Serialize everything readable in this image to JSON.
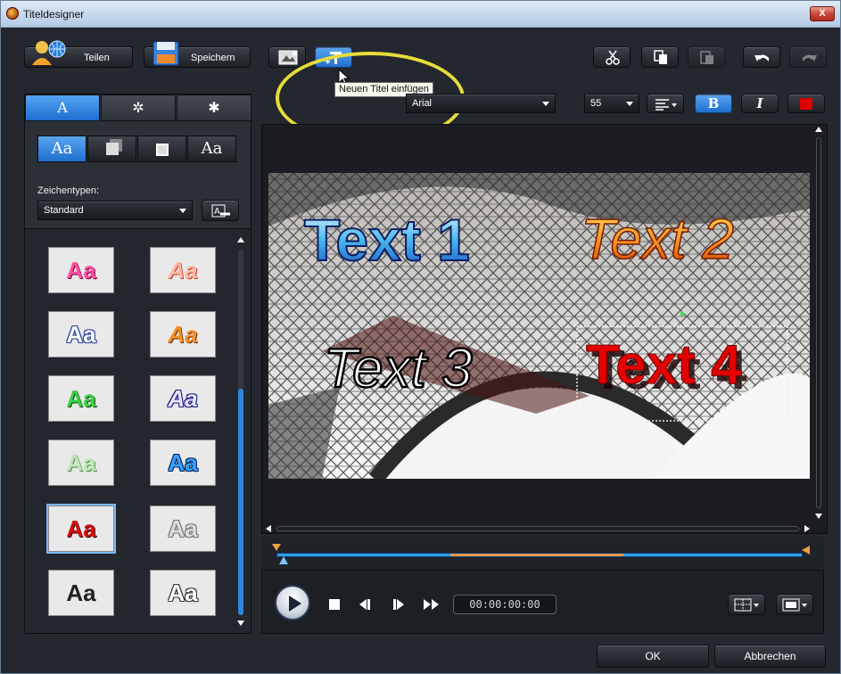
{
  "window": {
    "title": "Titeldesigner",
    "close_glyph": "X"
  },
  "toolbar": {
    "share_label": "Teilen",
    "save_label": "Speichern",
    "tooltip": "Neuen Titel einfügen"
  },
  "format": {
    "font": "Arial",
    "size": "55",
    "bold_label": "B",
    "italic_label": "I",
    "color": "#e00000"
  },
  "left_panel": {
    "tabs": [
      "A",
      "✲",
      "✱"
    ],
    "segments": [
      "Aa",
      "",
      "",
      "Aa"
    ],
    "charset_label": "Zeichentypen:",
    "charset_value": "Standard",
    "presets": [
      "Aa",
      "Aa",
      "Aa",
      "Aa",
      "Aa",
      "Aa",
      "Aa",
      "Aa",
      "Aa",
      "Aa",
      "Aa",
      "Aa"
    ]
  },
  "preview": {
    "texts": [
      "Text 1",
      "Text 2",
      "Text 3",
      "Text 4"
    ]
  },
  "player": {
    "timecode": "00:00:00:00"
  },
  "footer": {
    "ok_label": "OK",
    "cancel_label": "Abbrechen"
  },
  "colors": {
    "accent": "#1f6fd0",
    "highlight": "#e6dd3a",
    "timeline_blue": "#2f9fe0",
    "timeline_orange": "#e89a48"
  }
}
